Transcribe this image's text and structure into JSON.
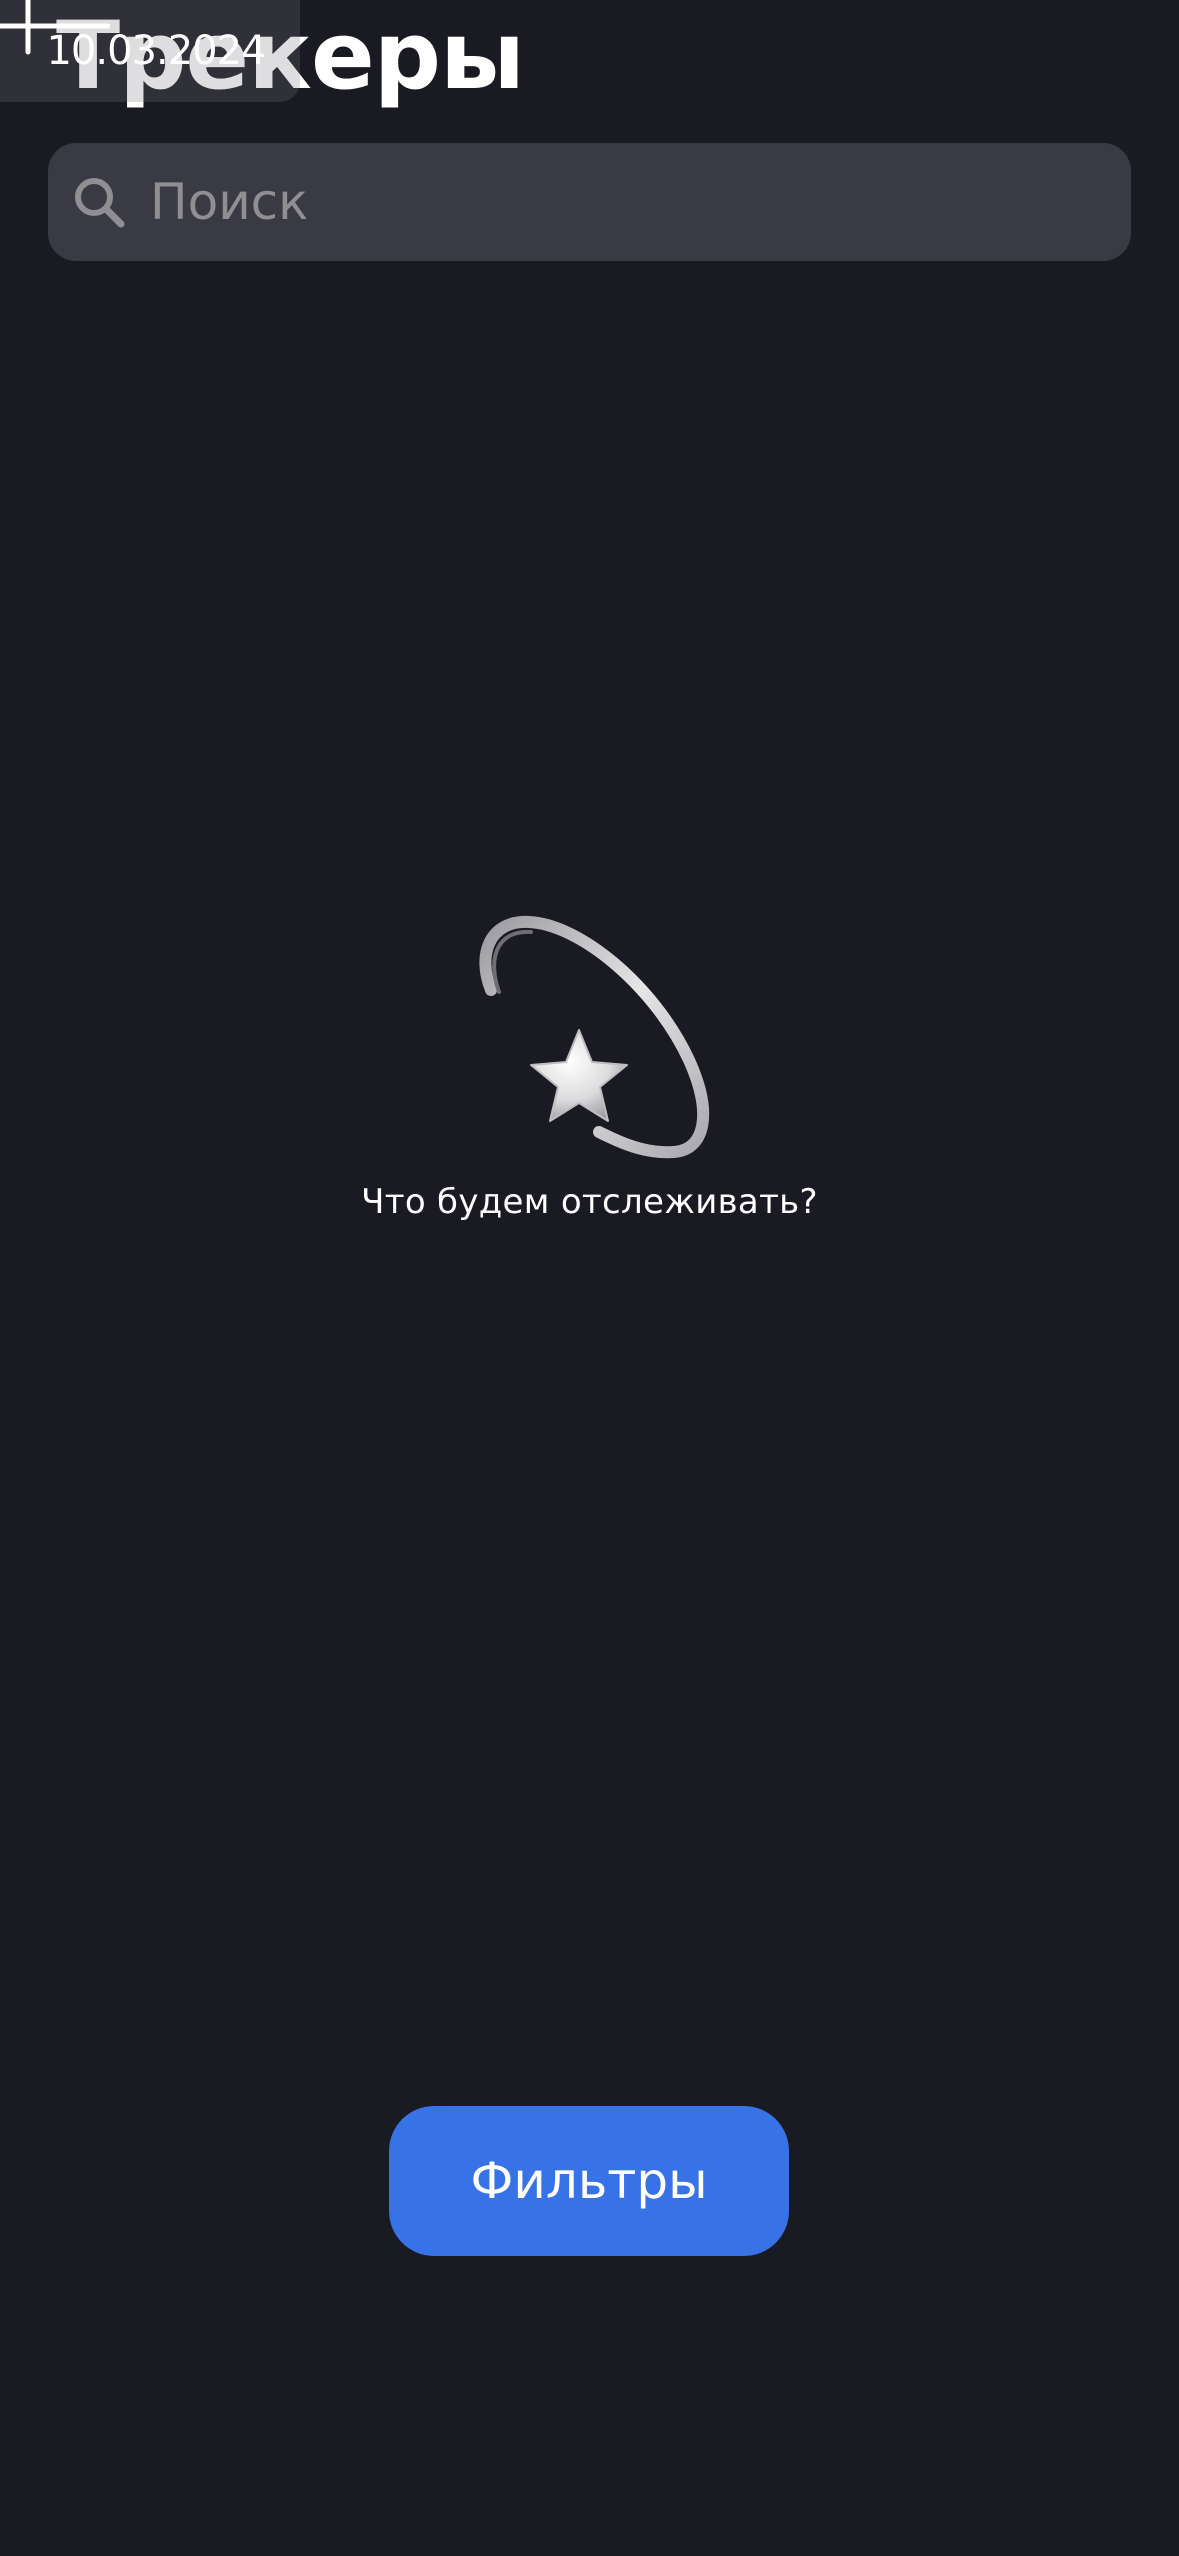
{
  "header": {
    "title": "Трекеры",
    "date": "10.03.2024",
    "add_icon": "plus-icon"
  },
  "search": {
    "placeholder": "Поиск",
    "value": "",
    "icon": "search-icon"
  },
  "empty_state": {
    "illustration": "dizzy-star-icon",
    "message": "Что будем отслеживать?"
  },
  "filters_button": {
    "label": "Фильтры"
  },
  "colors": {
    "background": "#1A1B22",
    "search_field": "#3A3A45",
    "placeholder": "#8E8E93",
    "accent_blue": "#3772E7",
    "text": "#FFFFFF"
  }
}
